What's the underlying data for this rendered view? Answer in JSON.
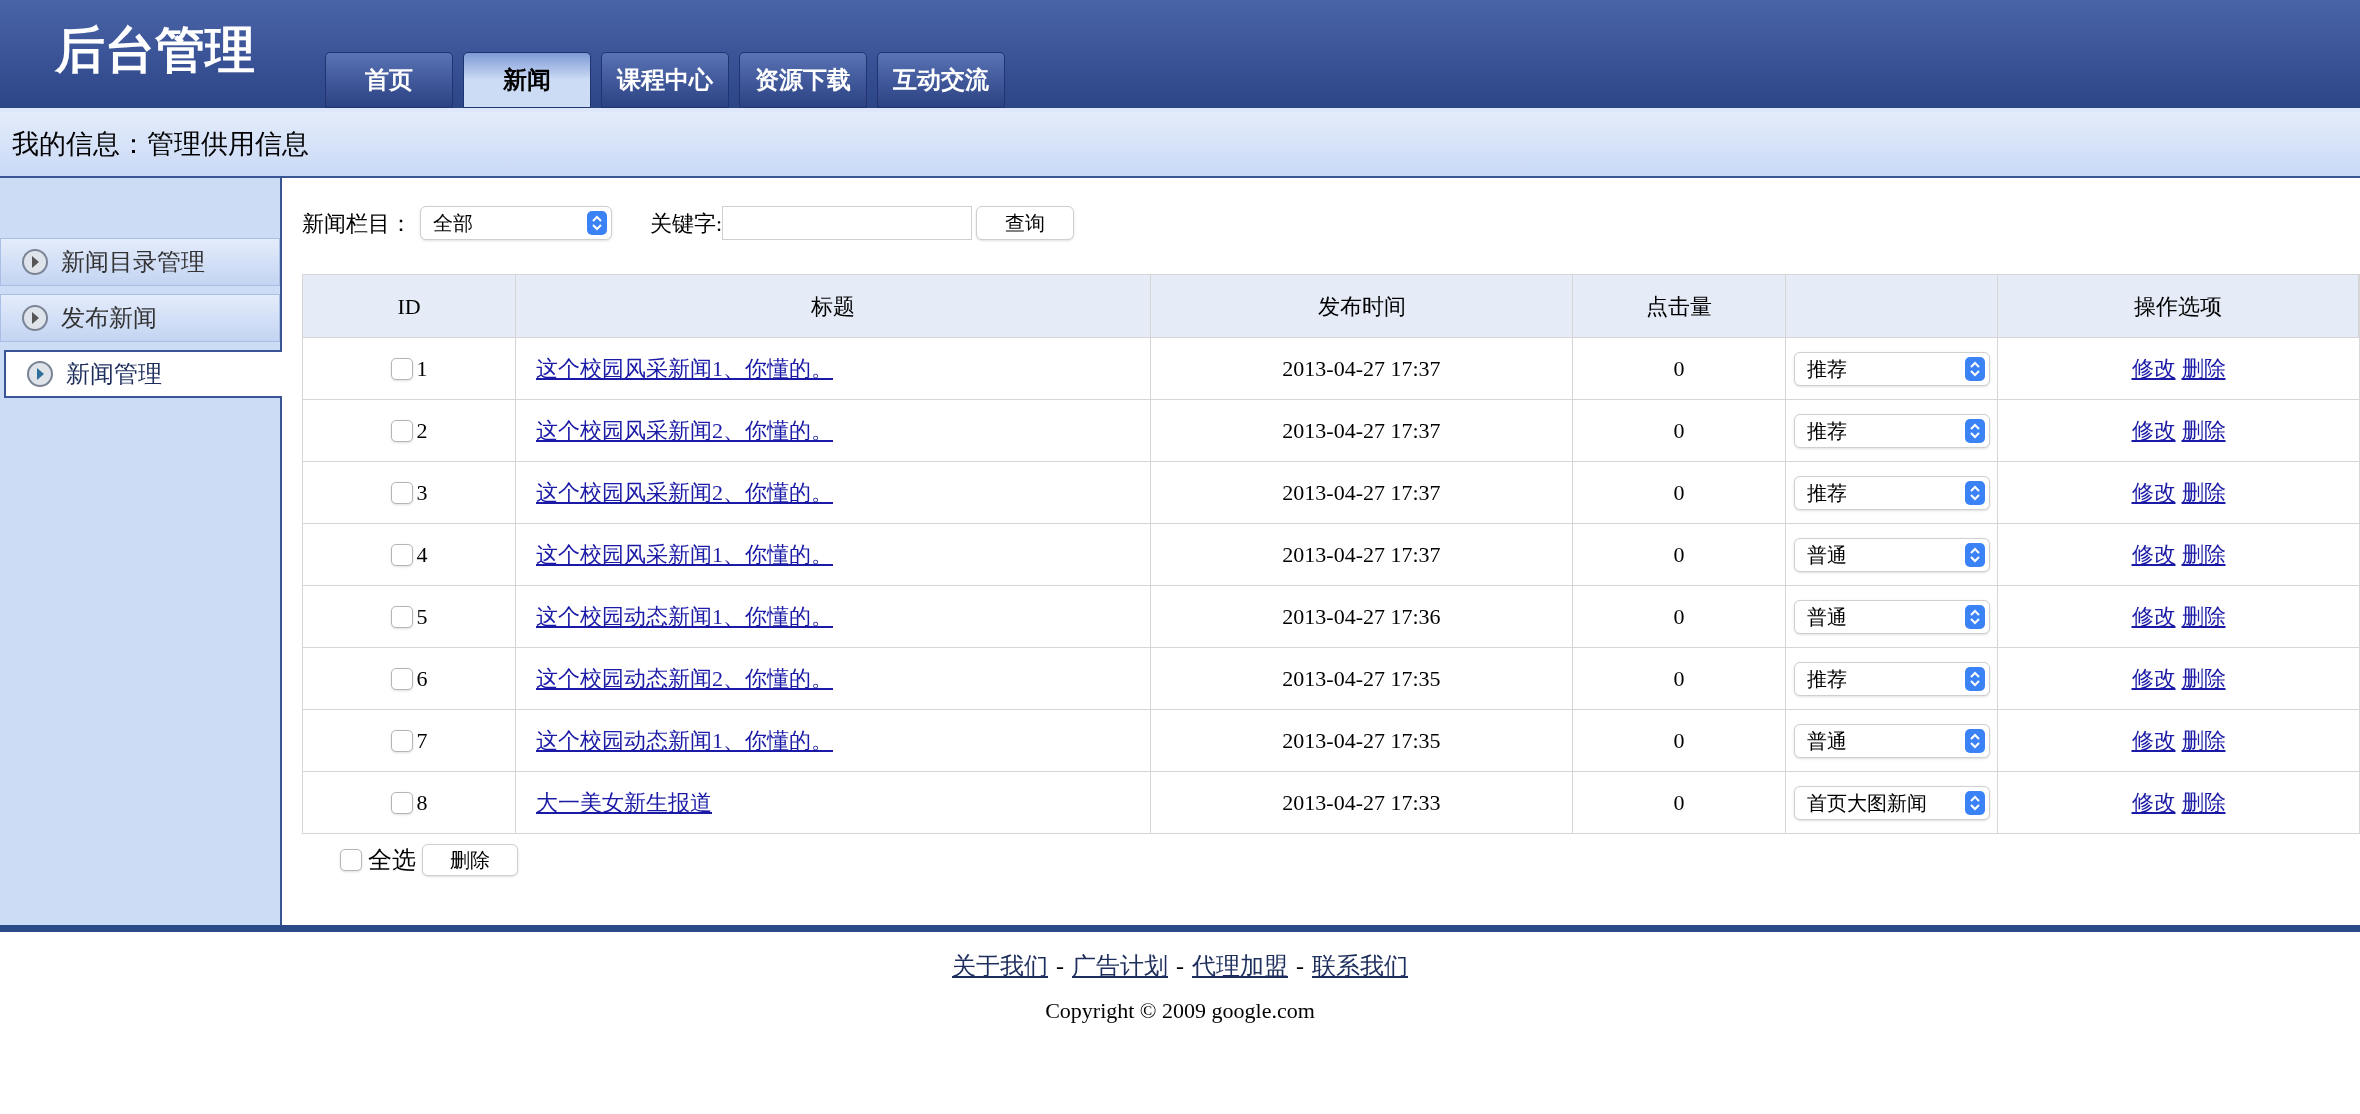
{
  "header": {
    "title": "后台管理",
    "tabs": [
      {
        "label": "首页",
        "selected": false
      },
      {
        "label": "新闻",
        "selected": true
      },
      {
        "label": "课程中心",
        "selected": false
      },
      {
        "label": "资源下载",
        "selected": false
      },
      {
        "label": "互动交流",
        "selected": false
      }
    ]
  },
  "info_bar": "我的信息：管理供用信息",
  "sidebar": {
    "items": [
      {
        "label": "新闻目录管理",
        "selected": false
      },
      {
        "label": "发布新闻",
        "selected": false
      },
      {
        "label": "新闻管理",
        "selected": true
      }
    ]
  },
  "filter": {
    "category_label": "新闻栏目：",
    "category_value": "全部",
    "keyword_label": "关键字:",
    "search_button": "查询"
  },
  "table": {
    "columns": [
      "ID",
      "标题",
      "发布时间",
      "点击量",
      "操作选项"
    ],
    "rows": [
      {
        "checked": false,
        "id": "1",
        "title": "这个校园风采新闻1、你懂的。",
        "time": "2013-04-27 17:37",
        "clicks": "0",
        "type": "推荐",
        "actions": [
          "修改",
          "删除"
        ]
      },
      {
        "checked": false,
        "id": "2",
        "title": "这个校园风采新闻2、你懂的。",
        "time": "2013-04-27 17:37",
        "clicks": "0",
        "type": "推荐",
        "actions": [
          "修改",
          "删除"
        ]
      },
      {
        "checked": false,
        "id": "3",
        "title": "这个校园风采新闻2、你懂的。",
        "time": "2013-04-27 17:37",
        "clicks": "0",
        "type": "推荐",
        "actions": [
          "修改",
          "删除"
        ]
      },
      {
        "checked": false,
        "id": "4",
        "title": "这个校园风采新闻1、你懂的。",
        "time": "2013-04-27 17:37",
        "clicks": "0",
        "type": "普通",
        "actions": [
          "修改",
          "删除"
        ]
      },
      {
        "checked": false,
        "id": "5",
        "title": "这个校园动态新闻1、你懂的。",
        "time": "2013-04-27 17:36",
        "clicks": "0",
        "type": "普通",
        "actions": [
          "修改",
          "删除"
        ]
      },
      {
        "checked": false,
        "id": "6",
        "title": "这个校园动态新闻2、你懂的。",
        "time": "2013-04-27 17:35",
        "clicks": "0",
        "type": "推荐",
        "actions": [
          "修改",
          "删除"
        ]
      },
      {
        "checked": false,
        "id": "7",
        "title": "这个校园动态新闻1、你懂的。",
        "time": "2013-04-27 17:35",
        "clicks": "0",
        "type": "普通",
        "actions": [
          "修改",
          "删除"
        ]
      },
      {
        "checked": false,
        "id": "8",
        "title": "大一美女新生报道",
        "time": "2013-04-27 17:33",
        "clicks": "0",
        "type": "首页大图新闻",
        "actions": [
          "修改",
          "删除"
        ]
      }
    ]
  },
  "bulk": {
    "select_all_label": "全选",
    "select_all_checked": false,
    "delete_button": "删除"
  },
  "footer": {
    "links": [
      {
        "label": "关于我们"
      },
      {
        "label": "广告计划"
      },
      {
        "label": "代理加盟"
      },
      {
        "label": "联系我们"
      }
    ],
    "separator": "-",
    "copyright": "Copyright © 2009 google.com"
  }
}
